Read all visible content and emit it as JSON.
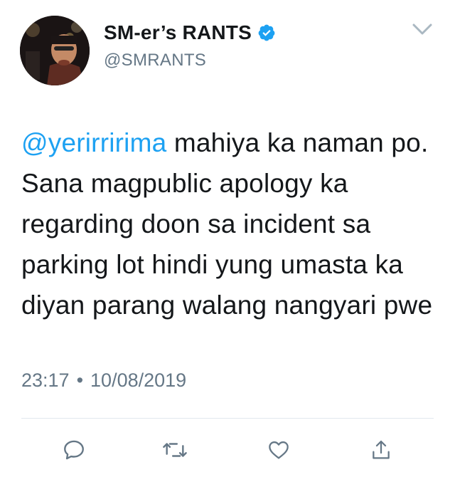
{
  "author": {
    "display_name": "SM-er’s RANTS",
    "handle": "@SMRANTS",
    "verified_icon": "verified-badge-icon",
    "avatar_icon": "profile-photo"
  },
  "tweet": {
    "mention": "@yerirririma",
    "body": " mahiya ka naman po. Sana magpublic apology ka regarding doon sa incident sa parking lot hindi yung umasta ka diyan parang walang nangyari pwe"
  },
  "meta": {
    "time": "23:17",
    "separator": "•",
    "date": "10/08/2019"
  },
  "actions": {
    "reply_icon": "comment-icon",
    "retweet_icon": "retweet-icon",
    "like_icon": "heart-icon",
    "share_icon": "share-icon",
    "menu_icon": "chevron-down-icon"
  },
  "colors": {
    "accent": "#1da1f2",
    "secondary_text": "#657786",
    "primary_text": "#14171a",
    "divider": "#e1e8ed"
  }
}
